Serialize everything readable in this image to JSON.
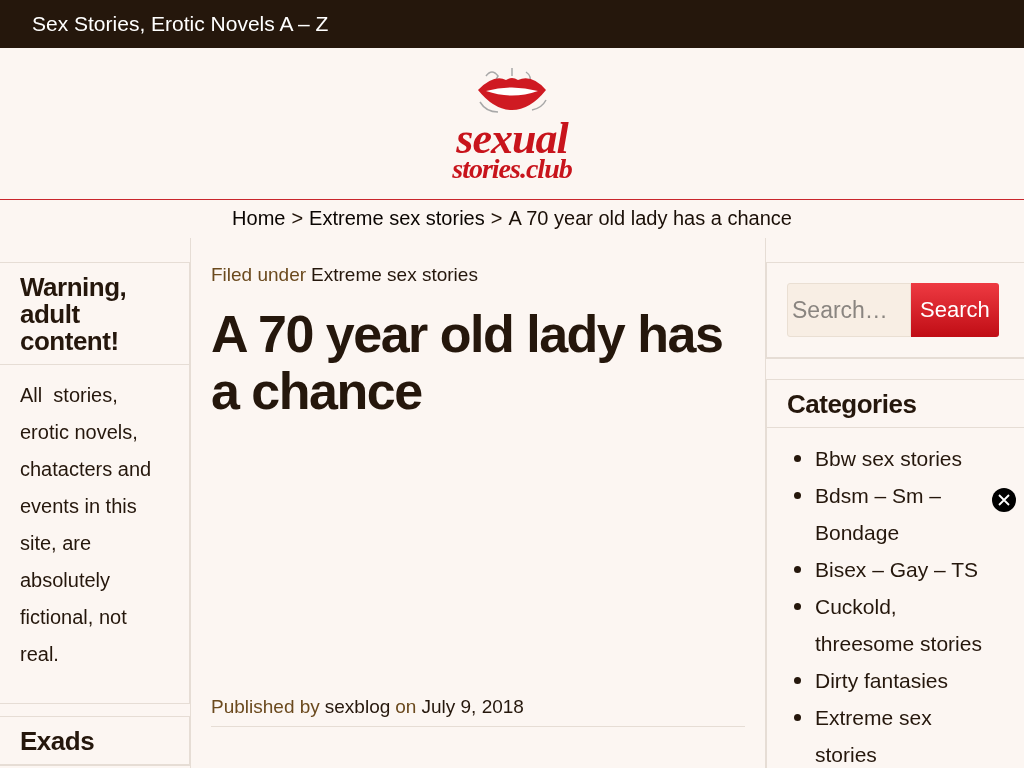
{
  "top_bar": {
    "title": "Sex Stories, Erotic Novels A – Z"
  },
  "logo": {
    "line_1": "sexual",
    "line_2": "stories.club"
  },
  "breadcrumb": [
    {
      "kind": "link",
      "text": "Home"
    },
    {
      "kind": "separator",
      "text": ">"
    },
    {
      "kind": "link",
      "text": "Extreme sex stories"
    },
    {
      "kind": "separator",
      "text": ">"
    },
    {
      "kind": "current",
      "text": "A 70 year old lady has a chance"
    }
  ],
  "left_sidebar": [
    {
      "title": "Warning, adult content!",
      "body": "All  stories, erotic novels, chatacters and events in this site, are absolutely fictional, not real."
    },
    {
      "title": "Exads"
    }
  ],
  "article": {
    "filed_under": [
      {
        "kind": "label",
        "text": "Filed under"
      },
      {
        "kind": "link",
        "text": "Extreme sex stories"
      }
    ],
    "title": "A 70 year old lady has a chance",
    "published": [
      {
        "kind": "label",
        "text": "Published by"
      },
      {
        "kind": "link",
        "text": "sexblog"
      },
      {
        "kind": "label",
        "text": "on"
      },
      {
        "kind": "link",
        "text": "July 9, 2018"
      }
    ]
  },
  "search": {
    "placeholder": "Search…",
    "button": "Search"
  },
  "categories": {
    "title": "Categories",
    "items": [
      "Bbw sex stories",
      "Bdsm – Sm – Bondage",
      "Bisex – Gay – TS",
      "Cuckold, threesome stories",
      "Dirty fantasies",
      "Extreme sex stories"
    ]
  }
}
